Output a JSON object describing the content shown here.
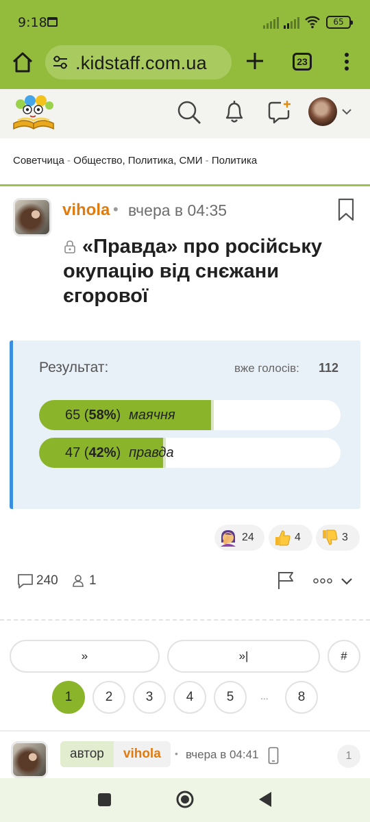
{
  "status_bar": {
    "time": "9:18",
    "battery": "65"
  },
  "browser": {
    "url": ".kidstaff.com.ua",
    "tab_count": "23"
  },
  "breadcrumb": {
    "items": [
      "Советчица",
      "Общество, Политика, СМИ",
      "Политика"
    ],
    "separator": "-"
  },
  "post": {
    "author": "vihola",
    "dot": "•",
    "time": "вчера в 04:35",
    "title": "«Правда» про російську окупацію від снєжани єгорової"
  },
  "poll": {
    "label": "Результат:",
    "votes_label": "вже голосів:",
    "votes_total": "112",
    "options": [
      {
        "count": "65",
        "percent": "58%",
        "percent_value": 58,
        "label": "маячня"
      },
      {
        "count": "47",
        "percent": "42%",
        "percent_value": 42,
        "label": "правда"
      }
    ]
  },
  "reactions": [
    {
      "icon": "facepalm-emoji-icon",
      "count": "24"
    },
    {
      "icon": "thumbs-up-emoji-icon",
      "count": "4"
    },
    {
      "icon": "thumbs-down-emoji-icon",
      "count": "3"
    }
  ],
  "stats": {
    "replies": "240",
    "watchers": "1"
  },
  "pagination": {
    "prev_label": "»",
    "last_label": "»|",
    "jump_label": "#",
    "pages": [
      "1",
      "2",
      "3",
      "4",
      "5",
      "8"
    ],
    "ellipsis": "...",
    "current": "1"
  },
  "reply": {
    "tag": "автор",
    "author": "vihola",
    "dot": "•",
    "time": "вчера в 04:41",
    "number": "1"
  },
  "colors": {
    "brand_green": "#93bb3c",
    "accent_orange": "#e07b10",
    "poll_bar": "#8ab42a",
    "poll_border": "#3b8ee0"
  }
}
